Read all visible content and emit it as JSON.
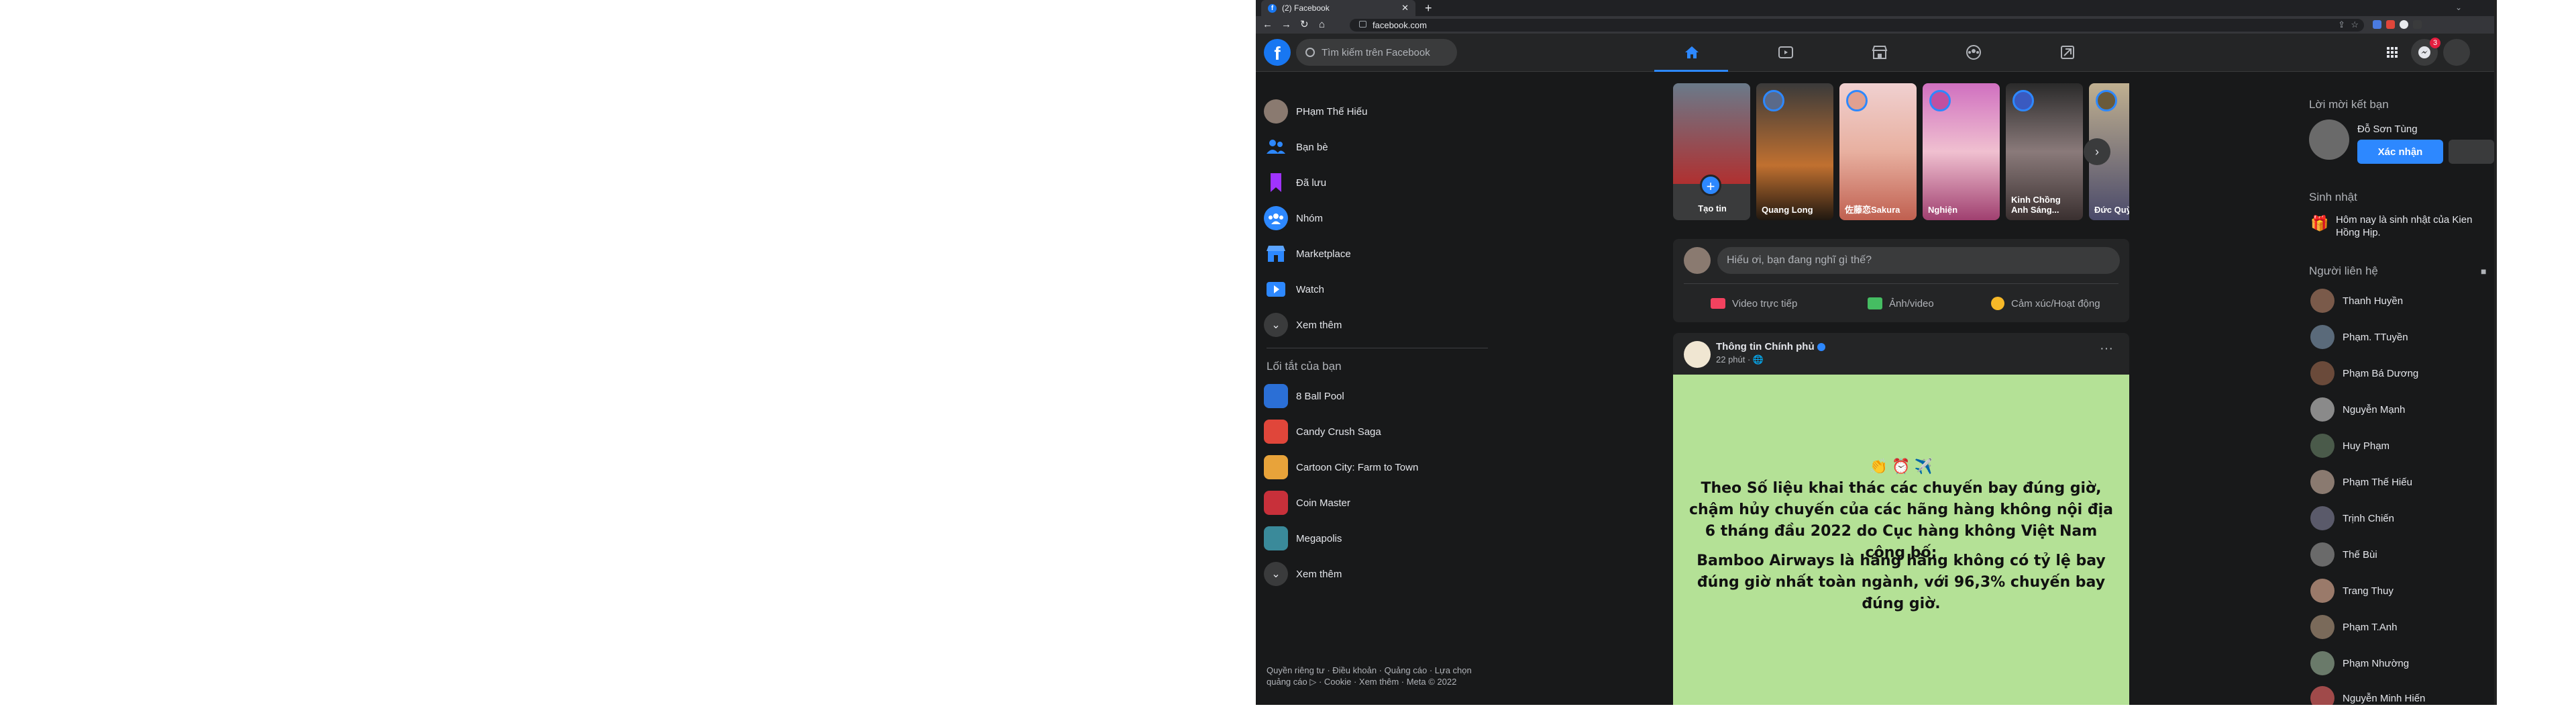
{
  "browser": {
    "tab_title": "(2) Facebook",
    "url": "facebook.com",
    "new_tab": "+",
    "close_tab": "✕"
  },
  "header": {
    "search_placeholder": "Tìm kiếm trên Facebook",
    "messenger_badge": "3"
  },
  "sidebar": {
    "items": [
      {
        "label": "PHạm Thế Hiếu",
        "color": "#8a7a70"
      },
      {
        "label": "Bạn bè",
        "color": "#2d88ff"
      },
      {
        "label": "Đã lưu",
        "color": "#a033ff"
      },
      {
        "label": "Nhóm",
        "color": "#2d88ff"
      },
      {
        "label": "Marketplace",
        "color": "#2d88ff"
      },
      {
        "label": "Watch",
        "color": "#2d88ff"
      },
      {
        "label": "Xem thêm",
        "color": "#3a3b3c"
      }
    ],
    "shortcuts_title": "Lối tắt của bạn",
    "shortcuts": [
      {
        "label": "8 Ball Pool",
        "color": "#2b6fd6"
      },
      {
        "label": "Candy Crush Saga",
        "color": "#e0463a"
      },
      {
        "label": "Cartoon City: Farm to Town",
        "color": "#e8a33a"
      },
      {
        "label": "Coin Master",
        "color": "#c8303a"
      },
      {
        "label": "Megapolis",
        "color": "#3a8a9a"
      },
      {
        "label": "Xem thêm",
        "color": "#3a3b3c"
      }
    ],
    "footer": "Quyền riêng tư · Điều khoản · Quảng cáo · Lựa chọn quảng cáo ▷ · Cookie · Xem thêm · Meta © 2022"
  },
  "stories": [
    {
      "name": "Tạo tin"
    },
    {
      "name": "Quang Long"
    },
    {
      "name": "佐藤恋Sakura"
    },
    {
      "name": "Nghiện"
    },
    {
      "name": "Kinh Chồng Anh Sáng..."
    },
    {
      "name": "Đức Quỳ"
    }
  ],
  "composer": {
    "placeholder": "Hiếu ơi, bạn đang nghĩ gì thế?",
    "live": "Video trực tiếp",
    "photo": "Ảnh/video",
    "feeling": "Cảm xúc/Hoạt động"
  },
  "post": {
    "author": "Thông tin Chính phủ",
    "time": "22 phút · 🌐",
    "emojis": "👏 ⏰ ✈️",
    "text1": "Theo Số liệu khai thác các chuyến bay đúng giờ, chậm hủy chuyến của các hãng hàng không nội địa 6 tháng đầu 2022 do Cục hàng không Việt Nam công bố:",
    "text2": "Bamboo Airways là hãng hàng không có tỷ lệ bay đúng giờ nhất toàn ngành, với 96,3% chuyến bay đúng giờ.",
    "more": "···"
  },
  "right": {
    "friend_requests_title": "Lời mời kết bạn",
    "request_name": "Đỗ Sơn Tùng",
    "confirm": "Xác nhận",
    "birthday_title": "Sinh nhật",
    "birthday_text": "Hôm nay là sinh nhật của Kien Hồng Hịp.",
    "contacts_title": "Người liên hệ",
    "contacts": [
      {
        "name": "Thanh Huyền",
        "color": "#7a5a4a"
      },
      {
        "name": "Phạm. TTuyền",
        "color": "#5a6a7a"
      },
      {
        "name": "Phạm Bá Dương",
        "color": "#6a4a3a"
      },
      {
        "name": "Nguyễn Mạnh",
        "color": "#8a8a8a"
      },
      {
        "name": "Huy Phạm",
        "color": "#4a5a4a"
      },
      {
        "name": "Phạm Thế Hiếu",
        "color": "#8a7a70"
      },
      {
        "name": "Trịnh Chiến",
        "color": "#5a5a6a"
      },
      {
        "name": "Thế Bùi",
        "color": "#6a6a6a"
      },
      {
        "name": "Trang Thuy",
        "color": "#9a7a6a"
      },
      {
        "name": "Phạm T.Anh",
        "color": "#7a6a5a"
      },
      {
        "name": "Phạm Nhường",
        "color": "#6a7a6a"
      },
      {
        "name": "Nguyễn Minh Hiến",
        "color": "#a04a4a"
      }
    ]
  }
}
